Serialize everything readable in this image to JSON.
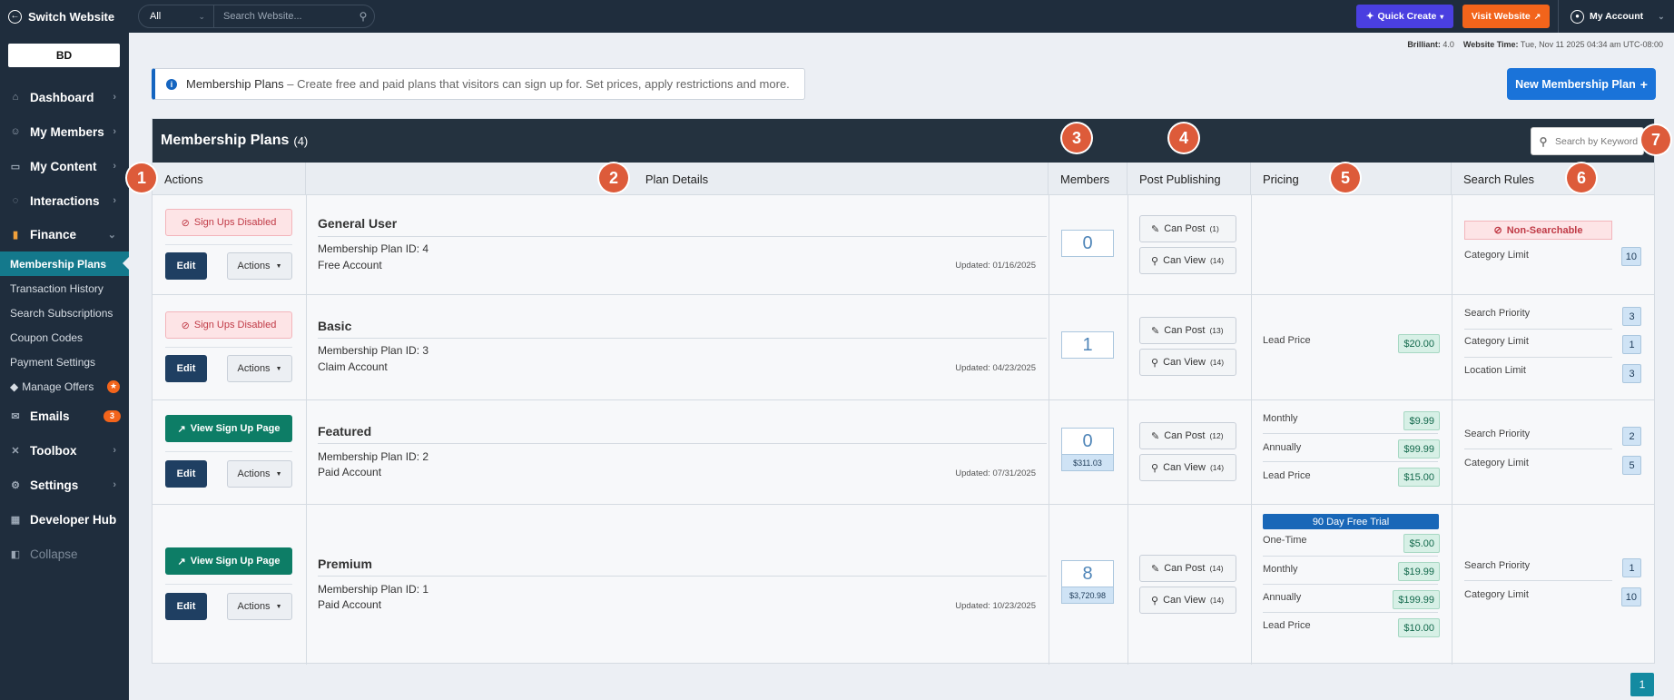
{
  "topbar": {
    "switch_label": "Switch Website",
    "search_scope": "All",
    "search_placeholder": "Search Website...",
    "quick_create": "Quick Create",
    "visit_website": "Visit Website",
    "my_account": "My Account"
  },
  "brand": {
    "logo_text": "BD"
  },
  "sidebar": {
    "dashboard": "Dashboard",
    "my_members": "My Members",
    "my_content": "My Content",
    "interactions": "Interactions",
    "finance": "Finance",
    "finance_sub": [
      "Membership Plans",
      "Transaction History",
      "Search Subscriptions",
      "Coupon Codes",
      "Payment Settings",
      "Manage Offers"
    ],
    "emails": "Emails",
    "emails_badge": "3",
    "toolbox": "Toolbox",
    "settings": "Settings",
    "developer_hub": "Developer Hub",
    "collapse": "Collapse"
  },
  "meta": {
    "brilliant_label": "Brilliant:",
    "brilliant_value": "4.0",
    "time_label": "Website Time:",
    "time_value": "Tue, Nov 11 2025 04:34 am UTC-08:00"
  },
  "info": {
    "title": "Membership Plans",
    "text": "– Create free and paid plans that visitors can sign up for. Set prices, apply restrictions and more."
  },
  "new_plan_button": "New Membership Plan",
  "panel": {
    "title": "Membership Plans",
    "count": "(4)",
    "keyword_placeholder": "Search by Keyword"
  },
  "columns": {
    "actions": "Actions",
    "plan_details": "Plan Details",
    "members": "Members",
    "post_publishing": "Post Publishing",
    "pricing": "Pricing",
    "search_rules": "Search Rules"
  },
  "labels": {
    "sign_ups_disabled": "Sign Ups Disabled",
    "view_sign_up_page": "View Sign Up Page",
    "edit": "Edit",
    "actions": "Actions",
    "plan_id": "Membership Plan ID:",
    "can_post": "Can Post",
    "can_view": "Can View",
    "non_searchable": "Non-Searchable"
  },
  "plans": [
    {
      "name": "General User",
      "id": "4",
      "account": "Free Account",
      "updated": "Updated: 01/16/2025",
      "members": "0",
      "member_value": "",
      "can_post": "(1)",
      "can_view": "(14)",
      "pricing": [],
      "search_rules": [
        {
          "label": "Category Limit",
          "value": "10"
        }
      ]
    },
    {
      "name": "Basic",
      "id": "3",
      "account": "Claim Account",
      "updated": "Updated: 04/23/2025",
      "members": "1",
      "member_value": "",
      "can_post": "(13)",
      "can_view": "(14)",
      "pricing": [
        {
          "label": "Lead Price",
          "value": "$20.00"
        }
      ],
      "search_rules": [
        {
          "label": "Search Priority",
          "value": "3"
        },
        {
          "label": "Category Limit",
          "value": "1"
        },
        {
          "label": "Location Limit",
          "value": "3"
        }
      ]
    },
    {
      "name": "Featured",
      "id": "2",
      "account": "Paid Account",
      "updated": "Updated: 07/31/2025",
      "members": "0",
      "member_value": "$311.03",
      "can_post": "(12)",
      "can_view": "(14)",
      "pricing": [
        {
          "label": "Monthly",
          "value": "$9.99"
        },
        {
          "label": "Annually",
          "value": "$99.99"
        },
        {
          "label": "Lead Price",
          "value": "$15.00"
        }
      ],
      "search_rules": [
        {
          "label": "Search Priority",
          "value": "2"
        },
        {
          "label": "Category Limit",
          "value": "5"
        }
      ]
    },
    {
      "name": "Premium",
      "id": "1",
      "account": "Paid Account",
      "updated": "Updated: 10/23/2025",
      "members": "8",
      "member_value": "$3,720.98",
      "can_post": "(14)",
      "can_view": "(14)",
      "trial": "90 Day Free Trial",
      "pricing": [
        {
          "label": "One-Time",
          "value": "$5.00"
        },
        {
          "label": "Monthly",
          "value": "$19.99"
        },
        {
          "label": "Annually",
          "value": "$199.99"
        },
        {
          "label": "Lead Price",
          "value": "$10.00"
        }
      ],
      "search_rules": [
        {
          "label": "Search Priority",
          "value": "1"
        },
        {
          "label": "Category Limit",
          "value": "10"
        }
      ]
    }
  ],
  "callouts": [
    "1",
    "2",
    "3",
    "4",
    "5",
    "6",
    "7"
  ],
  "pagination": {
    "current": "1"
  },
  "colors": {
    "nav_bg": "#1f2d3d",
    "accent_teal": "#14798c",
    "quick_create": "#4a3fe0",
    "visit_website": "#f2641b",
    "callout": "#dd5b3a"
  }
}
